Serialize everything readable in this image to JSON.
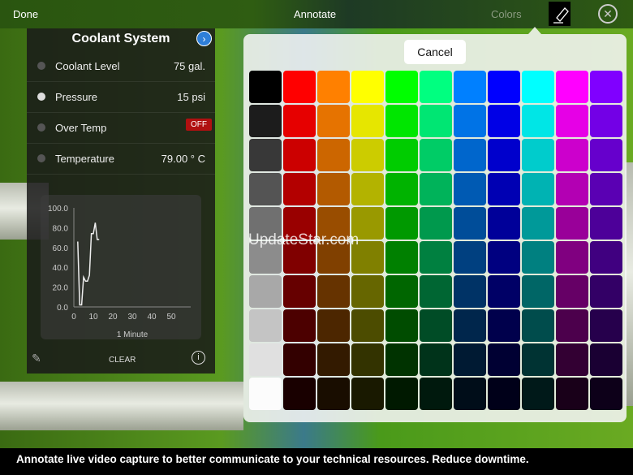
{
  "topbar": {
    "done": "Done",
    "title": "Annotate",
    "colors": "Colors"
  },
  "panel": {
    "title": "Coolant System",
    "rows": [
      {
        "label": "Coolant Level",
        "value": "75 gal."
      },
      {
        "label": "Pressure",
        "value": "15 psi"
      },
      {
        "label": "Over Temp",
        "value": "OFF"
      },
      {
        "label": "Temperature",
        "value": "79.00 ° C"
      }
    ],
    "clear": "CLEAR"
  },
  "chart_data": {
    "type": "line",
    "xlabel": "1 Minute",
    "ylabel": "",
    "xlim": [
      0,
      60
    ],
    "ylim": [
      0,
      100
    ],
    "xticks": [
      "0",
      "10",
      "20",
      "30",
      "40",
      "50"
    ],
    "yticks": [
      "0.0",
      "20.0",
      "40.0",
      "60.0",
      "80.0",
      "100.0"
    ],
    "x": [
      2,
      3,
      4,
      5,
      6,
      7,
      8,
      9,
      10,
      11,
      12,
      13
    ],
    "y": [
      66,
      2,
      2,
      30,
      26,
      26,
      32,
      74,
      74,
      85,
      68,
      68
    ]
  },
  "palette": {
    "cancel": "Cancel",
    "hues": [
      "#ff0000",
      "#ff8000",
      "#ffff00",
      "#00ff00",
      "#00ff80",
      "#0080ff",
      "#0000ff",
      "#00ffff",
      "#ff00ff",
      "#8000ff"
    ]
  },
  "watermark": "UpdateStar.com",
  "caption": "Annotate live video capture to better communicate to your technical resources.  Reduce downtime."
}
